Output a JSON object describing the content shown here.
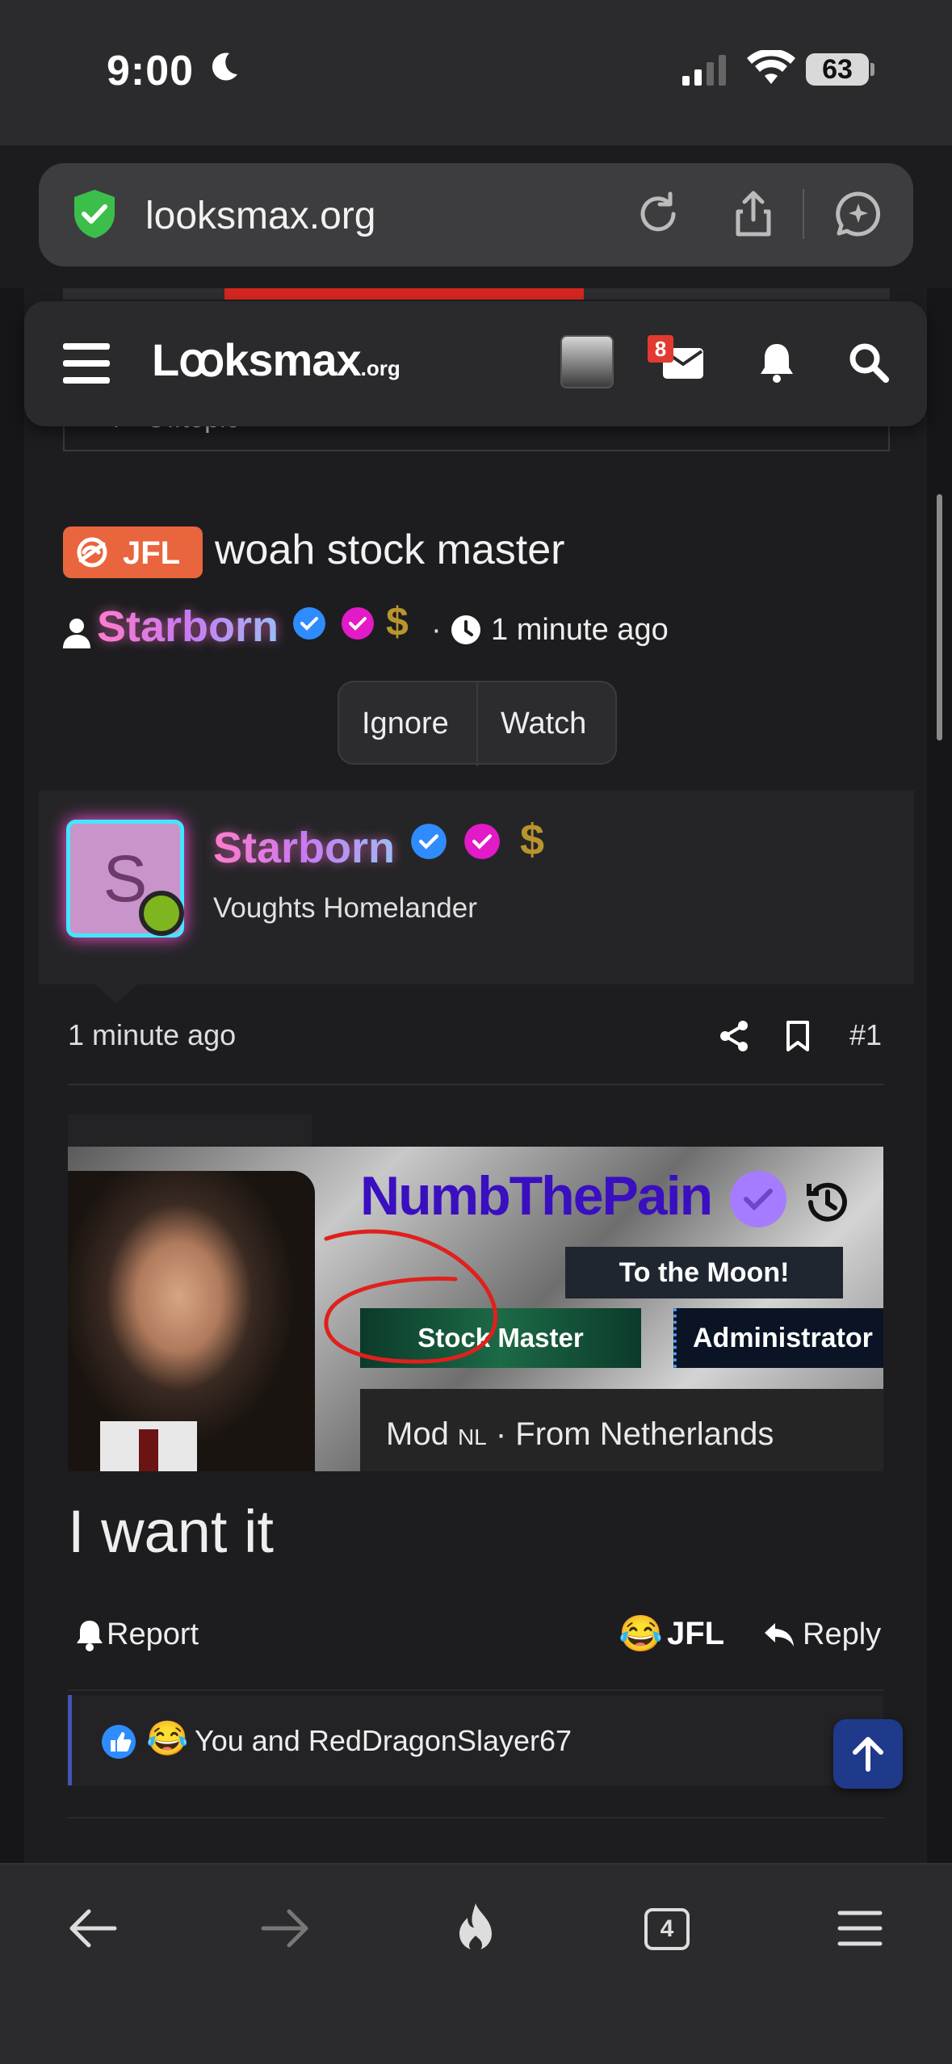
{
  "status_bar": {
    "time": "9:00",
    "battery": "63"
  },
  "browser": {
    "url": "looksmax.org",
    "tab_count": "4"
  },
  "site_nav": {
    "logo_main": "Lꝏksmax",
    "logo_suffix": ".org",
    "inbox_badge": "8"
  },
  "breadcrumb": {
    "label": "Offtopic"
  },
  "thread": {
    "prefix": "JFL",
    "title": "woah stock master",
    "author": "Starborn",
    "time": "1 minute ago",
    "ignore_label": "Ignore",
    "watch_label": "Watch"
  },
  "post": {
    "avatar_letter": "S",
    "author": "Starborn",
    "user_title": "Voughts Homelander",
    "time": "1 minute ago",
    "number": "#1",
    "body": "I want it",
    "report_label": "Report",
    "reaction_label": "JFL",
    "reply_label": "Reply",
    "reactions_text": "You and RedDragonSlayer67"
  },
  "embedded_image": {
    "username": "NumbThePain",
    "banner_moon": "To the Moon!",
    "banner_stock": "Stock Master",
    "banner_admin": "Administrator",
    "mod_line_a": "Mod ",
    "mod_line_nl": "NL",
    "mod_line_b": " · From Netherlands"
  },
  "colors": {
    "accent_red": "#d2261f",
    "prefix_orange": "#e9653d",
    "online_green": "#7fb51e",
    "badge_blue": "#2f8cff",
    "badge_magenta": "#e21ac7"
  }
}
